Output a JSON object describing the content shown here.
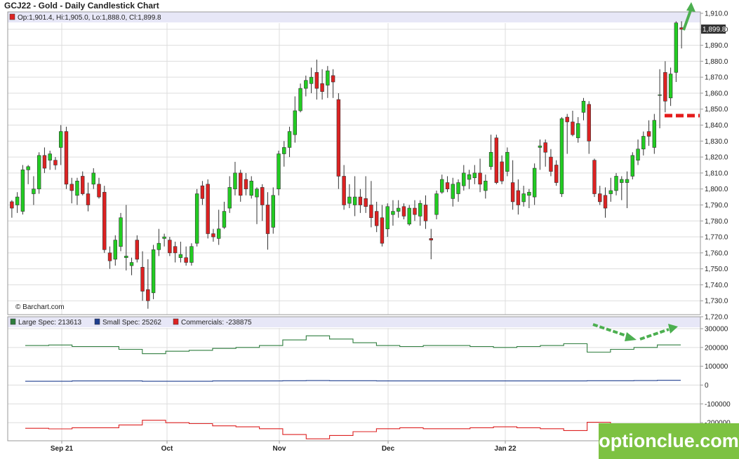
{
  "title": "GCJ22 - Gold - Daily Candlestick Chart",
  "ohlc_label": "Op:1,901.4, Hi:1,905.0, Lo:1,888.0, Cl:1,899.8",
  "last_price_label": "1,899.8",
  "copyright": "© Barchart.com",
  "watermark": "optionclue.com",
  "colors": {
    "up": "#22cc22",
    "down": "#dd2222",
    "large_spec": "#2e7d3e",
    "small_spec": "#1f3f8f",
    "commercials": "#dd2222",
    "annotation_green": "#4caf50",
    "annotation_red": "#e41b1b",
    "header_band": "#e7e7f7",
    "grid": "#dddddd"
  },
  "chart_data": [
    {
      "type": "candlestick",
      "title": "GCJ22 - Gold - Daily Candlestick Chart",
      "ylim": [
        1720,
        1910
      ],
      "y_ticks": [
        "1,720.0",
        "1,730.0",
        "1,740.0",
        "1,750.0",
        "1,760.0",
        "1,770.0",
        "1,780.0",
        "1,790.0",
        "1,800.0",
        "1,810.0",
        "1,820.0",
        "1,830.0",
        "1,840.0",
        "1,850.0",
        "1,860.0",
        "1,870.0",
        "1,880.0",
        "1,890.0",
        "1,900.0",
        "1,910.0"
      ],
      "x_labels": [
        "Sep 21",
        "Oct",
        "Nov",
        "Dec",
        "Jan 22"
      ],
      "annotations": [
        "up-arrow-after-last-candle",
        "dashed-line-at-1845"
      ],
      "candles": [
        [
          1792,
          1793,
          1782,
          1788
        ],
        [
          1790,
          1798,
          1785,
          1795
        ],
        [
          1786,
          1815,
          1784,
          1812
        ],
        [
          1812,
          1815,
          1803,
          1814
        ],
        [
          1797,
          1808,
          1790,
          1800
        ],
        [
          1800,
          1823,
          1797,
          1821
        ],
        [
          1821,
          1826,
          1810,
          1813
        ],
        [
          1818,
          1824,
          1812,
          1822
        ],
        [
          1818,
          1820,
          1812,
          1815
        ],
        [
          1826,
          1840,
          1815,
          1836
        ],
        [
          1836,
          1839,
          1800,
          1803
        ],
        [
          1803,
          1807,
          1791,
          1799
        ],
        [
          1796,
          1807,
          1790,
          1805
        ],
        [
          1808,
          1811,
          1796,
          1797
        ],
        [
          1797,
          1804,
          1786,
          1790
        ],
        [
          1803,
          1813,
          1800,
          1810
        ],
        [
          1803,
          1807,
          1794,
          1795
        ],
        [
          1798,
          1802,
          1760,
          1762
        ],
        [
          1760,
          1764,
          1750,
          1755
        ],
        [
          1756,
          1771,
          1752,
          1768
        ],
        [
          1764,
          1785,
          1761,
          1782
        ],
        [
          1757,
          1790,
          1749,
          1758
        ],
        [
          1752,
          1757,
          1746,
          1754
        ],
        [
          1768,
          1771,
          1754,
          1756
        ],
        [
          1751,
          1761,
          1730,
          1736
        ],
        [
          1737,
          1756,
          1725,
          1730
        ],
        [
          1735,
          1765,
          1731,
          1762
        ],
        [
          1762,
          1775,
          1758,
          1766
        ],
        [
          1769,
          1772,
          1764,
          1770
        ],
        [
          1768,
          1770,
          1758,
          1760
        ],
        [
          1764,
          1767,
          1754,
          1760
        ],
        [
          1757,
          1767,
          1754,
          1759
        ],
        [
          1757,
          1764,
          1752,
          1754
        ],
        [
          1754,
          1766,
          1752,
          1764
        ],
        [
          1766,
          1800,
          1764,
          1797
        ],
        [
          1802,
          1805,
          1790,
          1794
        ],
        [
          1803,
          1806,
          1769,
          1772
        ],
        [
          1772,
          1775,
          1767,
          1770
        ],
        [
          1769,
          1787,
          1765,
          1775
        ],
        [
          1776,
          1792,
          1775,
          1786
        ],
        [
          1788,
          1808,
          1785,
          1801
        ],
        [
          1800,
          1817,
          1796,
          1810
        ],
        [
          1810,
          1812,
          1792,
          1796
        ],
        [
          1806,
          1810,
          1796,
          1800
        ],
        [
          1796,
          1808,
          1794,
          1805
        ],
        [
          1795,
          1801,
          1778,
          1800
        ],
        [
          1801,
          1803,
          1780,
          1790
        ],
        [
          1790,
          1798,
          1762,
          1772
        ],
        [
          1776,
          1801,
          1772,
          1796
        ],
        [
          1800,
          1824,
          1796,
          1822
        ],
        [
          1822,
          1830,
          1814,
          1826
        ],
        [
          1826,
          1839,
          1820,
          1836
        ],
        [
          1834,
          1858,
          1829,
          1849
        ],
        [
          1849,
          1866,
          1848,
          1863
        ],
        [
          1863,
          1871,
          1858,
          1868
        ],
        [
          1866,
          1876,
          1860,
          1870
        ],
        [
          1873,
          1881,
          1856,
          1863
        ],
        [
          1866,
          1875,
          1856,
          1861
        ],
        [
          1865,
          1877,
          1857,
          1874
        ],
        [
          1871,
          1875,
          1857,
          1867
        ],
        [
          1856,
          1860,
          1800,
          1808
        ],
        [
          1808,
          1815,
          1787,
          1790
        ],
        [
          1791,
          1803,
          1788,
          1795
        ],
        [
          1790,
          1808,
          1783,
          1795
        ],
        [
          1795,
          1800,
          1785,
          1790
        ],
        [
          1794,
          1808,
          1785,
          1789
        ],
        [
          1790,
          1805,
          1776,
          1782
        ],
        [
          1786,
          1792,
          1773,
          1777
        ],
        [
          1782,
          1790,
          1764,
          1766
        ],
        [
          1775,
          1791,
          1770,
          1789
        ],
        [
          1784,
          1793,
          1777,
          1786
        ],
        [
          1786,
          1793,
          1782,
          1788
        ],
        [
          1789,
          1791,
          1781,
          1783
        ],
        [
          1778,
          1790,
          1777,
          1788
        ],
        [
          1788,
          1793,
          1780,
          1784
        ],
        [
          1783,
          1793,
          1777,
          1791
        ],
        [
          1790,
          1796,
          1775,
          1780
        ],
        [
          1769,
          1775,
          1756,
          1768
        ],
        [
          1784,
          1799,
          1781,
          1797
        ],
        [
          1798,
          1809,
          1797,
          1806
        ],
        [
          1804,
          1808,
          1798,
          1800
        ],
        [
          1794,
          1807,
          1789,
          1803
        ],
        [
          1797,
          1806,
          1792,
          1804
        ],
        [
          1802,
          1815,
          1799,
          1810
        ],
        [
          1806,
          1812,
          1800,
          1809
        ],
        [
          1807,
          1815,
          1803,
          1810
        ],
        [
          1810,
          1819,
          1798,
          1803
        ],
        [
          1799,
          1809,
          1794,
          1805
        ],
        [
          1814,
          1834,
          1812,
          1823
        ],
        [
          1832,
          1834,
          1803,
          1804
        ],
        [
          1817,
          1821,
          1803,
          1805
        ],
        [
          1811,
          1826,
          1808,
          1823
        ],
        [
          1804,
          1818,
          1787,
          1792
        ],
        [
          1799,
          1806,
          1784,
          1790
        ],
        [
          1792,
          1802,
          1789,
          1797
        ],
        [
          1796,
          1800,
          1788,
          1798
        ],
        [
          1795,
          1816,
          1790,
          1813
        ],
        [
          1826,
          1831,
          1812,
          1827
        ],
        [
          1829,
          1831,
          1814,
          1823
        ],
        [
          1820,
          1825,
          1808,
          1811
        ],
        [
          1815,
          1818,
          1802,
          1804
        ],
        [
          1797,
          1845,
          1795,
          1844
        ],
        [
          1845,
          1847,
          1822,
          1842
        ],
        [
          1842,
          1849,
          1833,
          1834
        ],
        [
          1832,
          1845,
          1829,
          1841
        ],
        [
          1848,
          1857,
          1843,
          1855
        ],
        [
          1853,
          1855,
          1822,
          1830
        ],
        [
          1818,
          1819,
          1795,
          1797
        ],
        [
          1797,
          1802,
          1790,
          1792
        ],
        [
          1796,
          1801,
          1782,
          1788
        ],
        [
          1797,
          1807,
          1792,
          1799
        ],
        [
          1799,
          1810,
          1796,
          1808
        ],
        [
          1804,
          1808,
          1793,
          1806
        ],
        [
          1804,
          1811,
          1788,
          1806
        ],
        [
          1808,
          1823,
          1806,
          1821
        ],
        [
          1818,
          1831,
          1815,
          1825
        ],
        [
          1825,
          1836,
          1821,
          1833
        ],
        [
          1836,
          1843,
          1827,
          1833
        ],
        [
          1826,
          1847,
          1822,
          1843
        ],
        [
          1859,
          1875,
          1838,
          1859
        ],
        [
          1873,
          1880,
          1848,
          1855
        ],
        [
          1857,
          1876,
          1852,
          1872
        ],
        [
          1873,
          1905,
          1867,
          1904
        ],
        [
          1901,
          1905,
          1888,
          1900
        ]
      ]
    },
    {
      "type": "line",
      "legend": [
        "Large Spec: 213613",
        "Small Spec: 25262",
        "Commercials: -238875"
      ],
      "ylim": [
        -300000,
        300000
      ],
      "y_ticks": [
        "300000",
        "200000",
        "100000",
        "0",
        "-100000",
        "-200000"
      ],
      "series": [
        {
          "name": "Large Spec",
          "values": [
            210000,
            213000,
            205000,
            205000,
            190000,
            167000,
            180000,
            185000,
            195000,
            200000,
            210000,
            240000,
            262000,
            245000,
            225000,
            210000,
            205000,
            210000,
            210000,
            205000,
            200000,
            205000,
            210000,
            220000,
            175000,
            190000,
            200000,
            213613
          ]
        },
        {
          "name": "Small Spec",
          "values": [
            20000,
            20000,
            22000,
            22000,
            22000,
            20000,
            20000,
            20000,
            22000,
            22000,
            22000,
            23000,
            24000,
            23000,
            23000,
            22000,
            22000,
            22000,
            22000,
            22000,
            22000,
            22000,
            22000,
            22000,
            23000,
            23000,
            24000,
            25262
          ]
        },
        {
          "name": "Commercials",
          "values": [
            -230000,
            -233000,
            -227000,
            -227000,
            -212000,
            -187000,
            -200000,
            -205000,
            -217000,
            -222000,
            -232000,
            -263000,
            -286000,
            -268000,
            -248000,
            -232000,
            -227000,
            -232000,
            -232000,
            -227000,
            -222000,
            -227000,
            -232000,
            -242000,
            -198000,
            -213000,
            -224000,
            -238875
          ]
        }
      ]
    }
  ]
}
